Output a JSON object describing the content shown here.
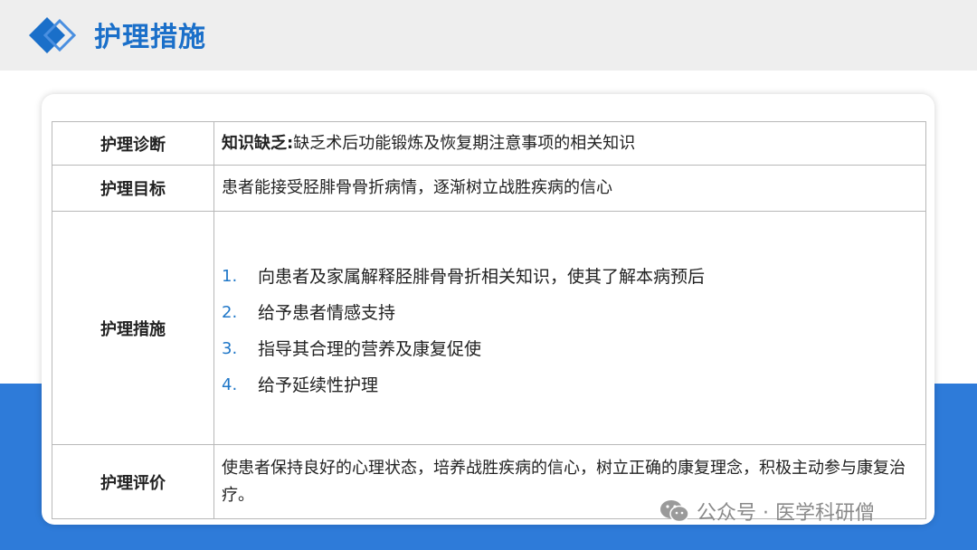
{
  "header": {
    "title": "护理措施"
  },
  "table": {
    "rows": [
      {
        "label": "护理诊断",
        "value_bold": "知识缺乏:",
        "value": "缺乏术后功能锻炼及恢复期注意事项的相关知识"
      },
      {
        "label": "护理目标",
        "value": "患者能接受胫腓骨骨折病情，逐渐树立战胜疾病的信心"
      },
      {
        "label": "护理措施",
        "items": [
          {
            "num": "1.",
            "text": "向患者及家属解释胫腓骨骨折相关知识，使其了解本病预后"
          },
          {
            "num": "2.",
            "text": "给予患者情感支持"
          },
          {
            "num": "3.",
            "text": "指导其合理的营养及康复促使"
          },
          {
            "num": "4.",
            "text": "给予延续性护理"
          }
        ]
      },
      {
        "label": "护理评价",
        "value": "使患者保持良好的心理状态，培养战胜疾病的信心，树立正确的康复理念，积极主动参与康复治疗。"
      }
    ]
  },
  "watermark": {
    "icon": "wechat-icon",
    "text": "公众号 · 医学科研僧"
  },
  "colors": {
    "accent": "#1a6fc9",
    "band": "#2e7bd9",
    "list_number": "#1f77c8"
  }
}
